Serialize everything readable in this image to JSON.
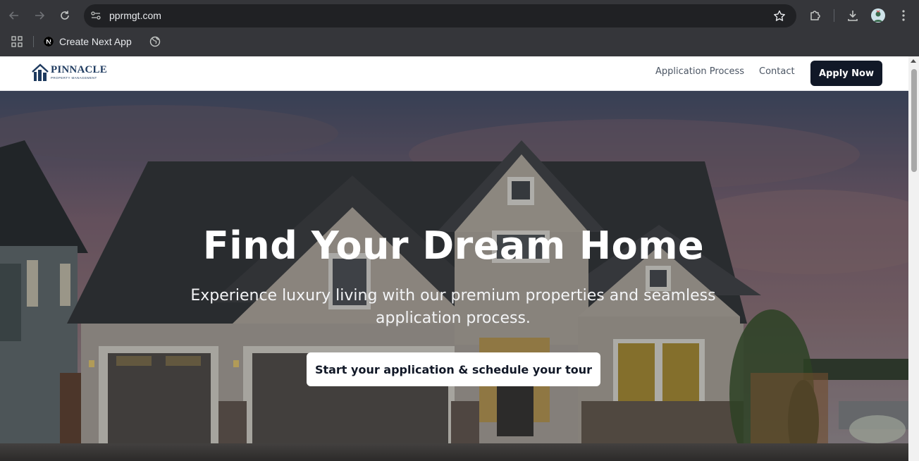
{
  "browser": {
    "url": "pprmgt.com",
    "bookmarks": [
      {
        "label": "Create Next App",
        "icon": "nextjs-icon"
      }
    ]
  },
  "site": {
    "logo": {
      "name": "PINNACLE",
      "tagline": "PROPERTY MANAGEMENT"
    },
    "nav": {
      "application_process": "Application Process",
      "contact": "Contact",
      "apply_now": "Apply Now"
    }
  },
  "hero": {
    "title": "Find Your Dream Home",
    "subtitle": "Experience luxury living with our premium properties and seamless application process.",
    "cta": "Start your application & schedule your tour"
  },
  "colors": {
    "brand_navy": "#1e3a5f",
    "button_dark": "#111827",
    "chrome_bg": "#35363a"
  }
}
